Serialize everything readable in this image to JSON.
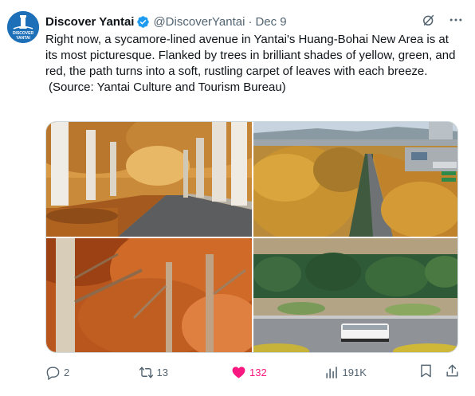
{
  "account": {
    "display_name": "Discover Yantai",
    "handle": "@DiscoverYantai",
    "separator": "·",
    "date": "Dec 9",
    "avatar_text_line1": "DISCOVER",
    "avatar_text_line2": "YANTAI",
    "verified": true
  },
  "tweet": {
    "body": "Right now, a sycamore-lined avenue in Yantai's Huang-Bohai New Area is at its most picturesque. Flanked by trees in brilliant shades of yellow, green, and red, the path turns into a soft, rustling carpet of leaves with each breeze.",
    "source": "(Source: Yantai Culture and Tourism Bureau)"
  },
  "media": [
    {
      "description": "tree-lined road with fallen leaves"
    },
    {
      "description": "aerial view of autumn avenue"
    },
    {
      "description": "red-orange sycamore canopy"
    },
    {
      "description": "overhead view of tree row and bus"
    }
  ],
  "metrics": {
    "replies": "2",
    "reposts": "13",
    "likes": "132",
    "views": "191K"
  },
  "icons": {
    "header": [
      "grok-icon",
      "more-icon"
    ],
    "actions": [
      "reply-icon",
      "repost-icon",
      "like-icon",
      "views-icon",
      "bookmark-icon",
      "share-icon"
    ]
  },
  "colors": {
    "like_active": "#f91880",
    "secondary_text": "#536471",
    "verified_badge": "#1d9bf0",
    "avatar_bg": "#1d6fb8"
  }
}
